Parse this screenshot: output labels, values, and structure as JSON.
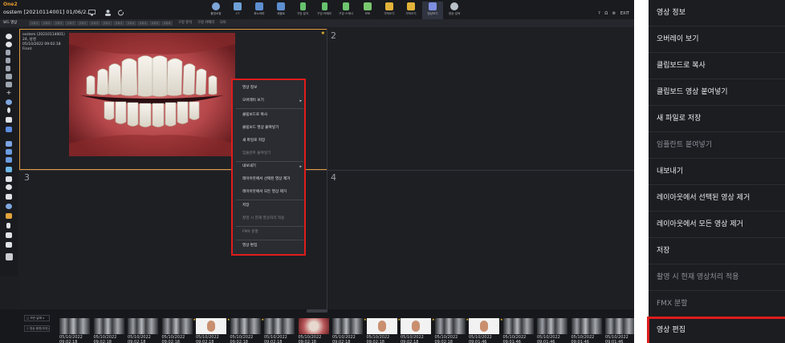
{
  "app": {
    "logo": "One2",
    "patient_title": "osstem [20210114001] 01/06/2...",
    "window_controls": [
      "?",
      "Ω",
      "⚙",
      "EXIT"
    ]
  },
  "toolbar": {
    "tools": [
      {
        "label": "촬영요청",
        "icon": "capture-request-icon",
        "color": "#7fa6d8"
      },
      {
        "label": "CT",
        "icon": "ct-icon",
        "color": "#6ea0d6"
      },
      {
        "label": "파노라마",
        "icon": "panorama-icon",
        "color": "#5d8fd0"
      },
      {
        "label": "세팔로",
        "icon": "cephalo-icon",
        "color": "#5d8fd0"
      },
      {
        "label": "구강 분석",
        "icon": "oral-analysis-icon",
        "color": "#66c26e"
      },
      {
        "label": "구강 카메라",
        "icon": "intraoral-camera-icon",
        "color": "#66c26e"
      },
      {
        "label": "구강 스캐너",
        "icon": "oral-scanner-icon",
        "color": "#6fc46f"
      },
      {
        "label": "모토",
        "icon": "photo-icon",
        "color": "#7ac86e"
      },
      {
        "label": "가져오기",
        "icon": "import-icon",
        "color": "#e2b33a"
      },
      {
        "label": "가져오기",
        "icon": "folder-icon",
        "color": "#e2b33a"
      },
      {
        "label": "영상보기",
        "icon": "image-view-icon",
        "color": "#7d8fe0"
      },
      {
        "label": "영상 검색",
        "icon": "image-search-icon",
        "color": "#b9c0c8"
      }
    ]
  },
  "tabs": {
    "first": "보드 영상",
    "segments": [
      "1 8 1",
      "1 8 2",
      "1 8 3",
      "2 8 7",
      "2 8 2",
      "2 8 3",
      "3 8 1",
      "3 8 3",
      "3 8 4",
      "4 8 4",
      "4 8 5",
      "4 8 6"
    ],
    "extra": [
      "구강 분석",
      "구강 카메라",
      "모토"
    ]
  },
  "viewport1": {
    "info": [
      "osstem (20210114001)",
      "24, 남성",
      "",
      "05/10/2022 09:02:18",
      "Front"
    ],
    "number": "1"
  },
  "viewports": {
    "v2": "2",
    "v3": "3",
    "v4": "4"
  },
  "context_menu": {
    "items": [
      {
        "label": "영상 정보",
        "disabled": false,
        "submenu": false
      },
      {
        "label": "오버레이 보기",
        "disabled": false,
        "submenu": true
      },
      {
        "label": "클립보드로 복사",
        "disabled": false,
        "submenu": false
      },
      {
        "label": "클립보드 영상 붙여넣기",
        "disabled": false,
        "submenu": false
      },
      {
        "label": "새 파일로 저장",
        "disabled": false,
        "submenu": false
      },
      {
        "label": "임플란트 붙여넣기",
        "disabled": true,
        "submenu": false
      },
      {
        "label": "내보내기",
        "disabled": false,
        "submenu": true
      },
      {
        "label": "레이아웃에서 선택된 영상 제거",
        "disabled": false,
        "submenu": false
      },
      {
        "label": "레이아웃에서 모든 영상 제거",
        "disabled": false,
        "submenu": false
      },
      {
        "label": "저장",
        "disabled": false,
        "submenu": false
      },
      {
        "label": "촬영 시 현재 영상처리 적용",
        "disabled": true,
        "submenu": false
      },
      {
        "label": "FMX 분할",
        "disabled": true,
        "submenu": false
      },
      {
        "label": "영상 편집",
        "disabled": false,
        "submenu": false
      }
    ]
  },
  "thumbnails": {
    "side_buttons": [
      "□ 모든 날짜 ∨",
      "▽ 영상 종류(미지) ∨"
    ],
    "captions": [
      "05/10/2022 09:02:18",
      "05/10/2022 09:02:18",
      "05/10/2022 09:02:18",
      "05/10/2022 09:02:18",
      "05/10/2022 09:02:18",
      "05/10/2022 09:02:18",
      "05/10/2022 09:02:18",
      "05/10/2022 09:02:18",
      "05/10/2022 09:02:18",
      "05/10/2022 09:02:18",
      "05/10/2022 09:02:18",
      "05/10/2022 09:02:18",
      "05/10/2022 09:01:46",
      "05/10/2022 09:01:46",
      "05/10/2022 09:01:46",
      "05/10/2022 09:01:46",
      "05/10/2022 09:01:46"
    ]
  }
}
